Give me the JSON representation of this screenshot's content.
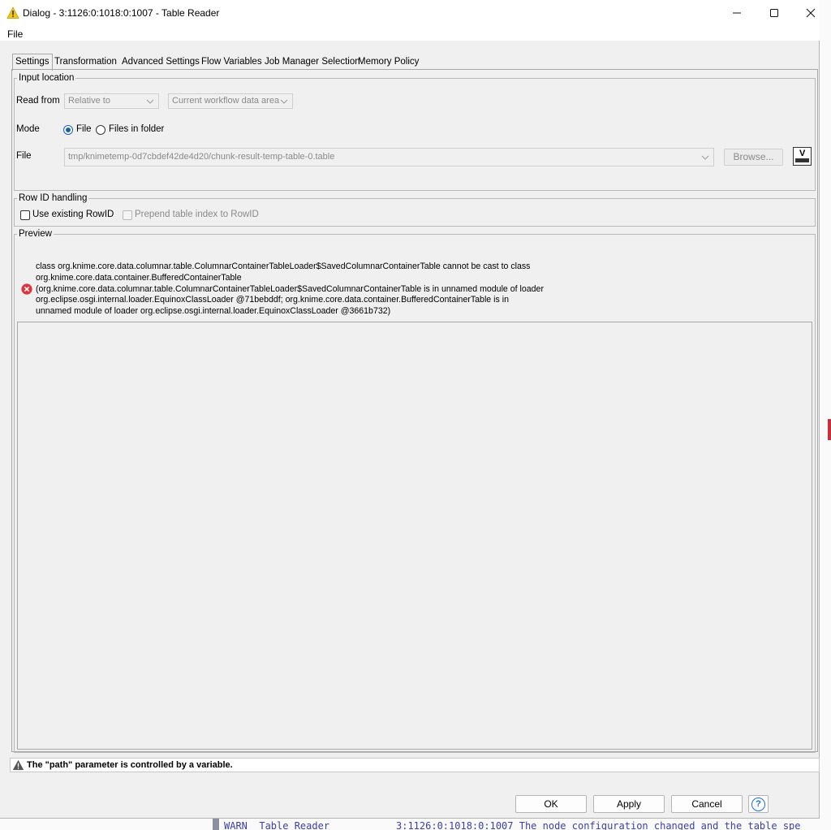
{
  "window": {
    "title": "Dialog - 3:1126:0:1018:0:1007 - Table Reader",
    "minimize_icon": "minimize-icon",
    "maximize_icon": "maximize-icon",
    "close_icon": "close-icon"
  },
  "menu": {
    "file": "File"
  },
  "tabs": [
    "Settings",
    "Transformation",
    "Advanced Settings",
    "Flow Variables",
    "Job Manager Selection",
    "Memory Policy"
  ],
  "input_location": {
    "legend": "Input location",
    "read_from_label": "Read from",
    "read_from_value": "Relative to",
    "read_from_target": "Current workflow data area",
    "mode_label": "Mode",
    "mode_options": [
      "File",
      "Files in folder"
    ],
    "mode_selected": "File",
    "file_label": "File",
    "file_path": "tmp/knimetemp-0d7cbdef42de4d20/chunk-result-temp-table-0.table",
    "browse_label": "Browse...",
    "variable_button_label": "V"
  },
  "row_id": {
    "legend": "Row ID handling",
    "use_existing": "Use existing RowID",
    "prepend_index": "Prepend table index to RowID"
  },
  "preview": {
    "legend": "Preview",
    "error_lines": [
      "class org.knime.core.data.columnar.table.ColumnarContainerTableLoader$SavedColumnarContainerTable cannot be cast to class",
      "org.knime.core.data.container.BufferedContainerTable",
      "(org.knime.core.data.columnar.table.ColumnarContainerTableLoader$SavedColumnarContainerTable is in unnamed module of loader",
      "org.eclipse.osgi.internal.loader.EquinoxClassLoader @71bebddf; org.knime.core.data.container.BufferedContainerTable is in",
      "unnamed module of loader org.eclipse.osgi.internal.loader.EquinoxClassLoader @3661b732)"
    ]
  },
  "status": {
    "message": "The \"path\" parameter is controlled by a variable."
  },
  "buttons": {
    "ok": "OK",
    "apply": "Apply",
    "cancel": "Cancel",
    "help": "?"
  },
  "background_console": {
    "level": "WARN  Table Reader",
    "message": "3:1126:0:1018:0:1007 The node configuration changed and the table spe"
  },
  "colors": {
    "accent": "#1a5fb4",
    "error": "#e0313c",
    "warning": "#f2c811"
  }
}
